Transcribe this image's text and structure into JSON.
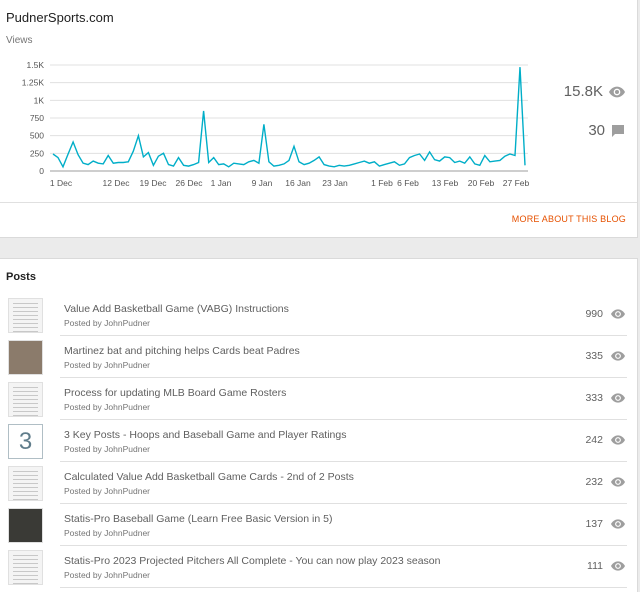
{
  "blog": {
    "name": "PudnerSports.com",
    "views_label": "Views"
  },
  "stats": {
    "total_views": "15.8K",
    "total_comments": "30",
    "more_link": "MORE ABOUT THIS BLOG"
  },
  "colors": {
    "line": "#00aec8",
    "accent": "#e65100",
    "icon": "#9e9e9e"
  },
  "chart_data": {
    "type": "line",
    "title": "",
    "ylabel": "Views",
    "ylim": [
      0,
      1500
    ],
    "y_ticks": [
      "0",
      "250",
      "500",
      "750",
      "1K",
      "1.25K",
      "1.5K"
    ],
    "x_ticks": [
      "1 Dec",
      "12 Dec",
      "19 Dec",
      "26 Dec",
      "1 Jan",
      "9 Jan",
      "16 Jan",
      "23 Jan",
      "1 Feb",
      "6 Feb",
      "13 Feb",
      "20 Feb",
      "27 Feb"
    ],
    "grid": true,
    "series": [
      {
        "values": [
          240,
          190,
          60,
          240,
          410,
          230,
          110,
          90,
          140,
          110,
          100,
          220,
          110,
          120,
          120,
          130,
          280,
          500,
          200,
          260,
          80,
          210,
          250,
          90,
          70,
          190,
          80,
          70,
          90,
          120,
          850,
          120,
          190,
          90,
          100,
          60,
          110,
          100,
          90,
          130,
          150,
          110,
          660,
          130,
          70,
          80,
          100,
          150,
          350,
          130,
          90,
          110,
          150,
          200,
          90,
          70,
          60,
          80,
          70,
          80,
          100,
          120,
          140,
          110,
          130,
          70,
          90,
          110,
          130,
          80,
          100,
          190,
          220,
          240,
          150,
          270,
          160,
          140,
          200,
          190,
          120,
          140,
          110,
          200,
          100,
          80,
          220,
          130,
          140,
          150,
          210,
          240,
          220,
          1470,
          80
        ]
      }
    ]
  },
  "posts": {
    "title": "Posts",
    "items": [
      {
        "title": "Value Add Basketball Game (VABG) Instructions",
        "author": "Posted by JohnPudner",
        "views": "990"
      },
      {
        "title": "Martinez bat and pitching helps Cards beat Padres",
        "author": "Posted by JohnPudner",
        "views": "335"
      },
      {
        "title": "Process for updating MLB Board Game Rosters",
        "author": "Posted by JohnPudner",
        "views": "333"
      },
      {
        "title": "3 Key Posts - Hoops and Baseball Game and Player Ratings",
        "author": "Posted by JohnPudner",
        "views": "242",
        "thumb_text": "3"
      },
      {
        "title": "Calculated Value Add Basketball Game Cards - 2nd of 2 Posts",
        "author": "Posted by JohnPudner",
        "views": "232"
      },
      {
        "title": "Statis-Pro Baseball Game (Learn Free Basic Version in 5)",
        "author": "Posted by JohnPudner",
        "views": "137"
      },
      {
        "title": "Statis-Pro 2023 Projected Pitchers All Complete - You can now play 2023 season",
        "author": "Posted by JohnPudner",
        "views": "111"
      }
    ]
  }
}
